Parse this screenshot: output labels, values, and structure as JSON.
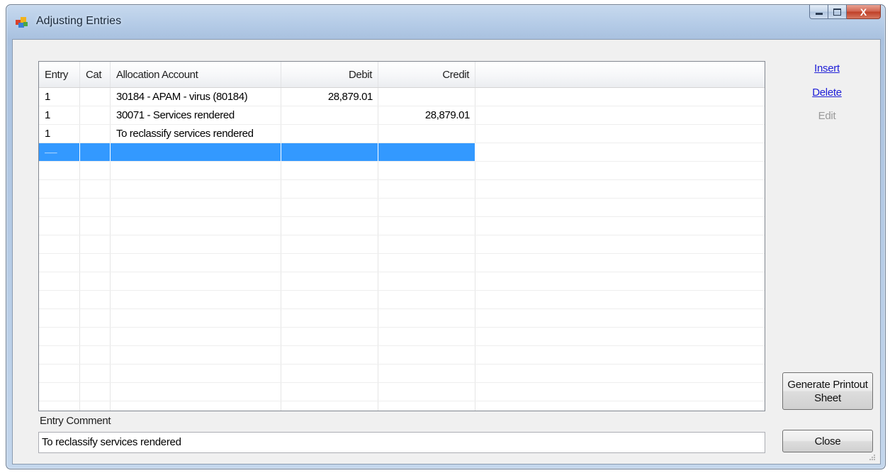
{
  "window": {
    "title": "Adjusting Entries",
    "icon": "app-blocks-icon",
    "caption_buttons": {
      "minimize": "—",
      "maximize": "▢",
      "close": "X"
    }
  },
  "grid": {
    "columns": [
      {
        "key": "entry",
        "label": "Entry"
      },
      {
        "key": "cat",
        "label": "Cat"
      },
      {
        "key": "account",
        "label": "Allocation Account"
      },
      {
        "key": "debit",
        "label": "Debit"
      },
      {
        "key": "credit",
        "label": "Credit"
      }
    ],
    "rows": [
      {
        "entry": "1",
        "cat": "",
        "account": "30184 - APAM - virus (80184)",
        "debit": "28,879.01",
        "credit": ""
      },
      {
        "entry": "1",
        "cat": "",
        "account": "30071 - Services rendered",
        "debit": "",
        "credit": "28,879.01"
      },
      {
        "entry": "1",
        "cat": "",
        "account": "To reclassify services rendered",
        "debit": "",
        "credit": ""
      },
      {
        "entry": "——",
        "cat": "",
        "account": "",
        "debit": "",
        "credit": ""
      }
    ],
    "selected_row": 3
  },
  "actions": {
    "insert": "Insert",
    "delete": "Delete",
    "edit": "Edit",
    "generate": "Generate Printout Sheet",
    "close": "Close"
  },
  "comment": {
    "label": "Entry Comment",
    "value": "To reclassify services rendered"
  },
  "colors": {
    "selection": "#3399ff",
    "link": "#2020d8",
    "disabled": "#9a9a9a"
  }
}
